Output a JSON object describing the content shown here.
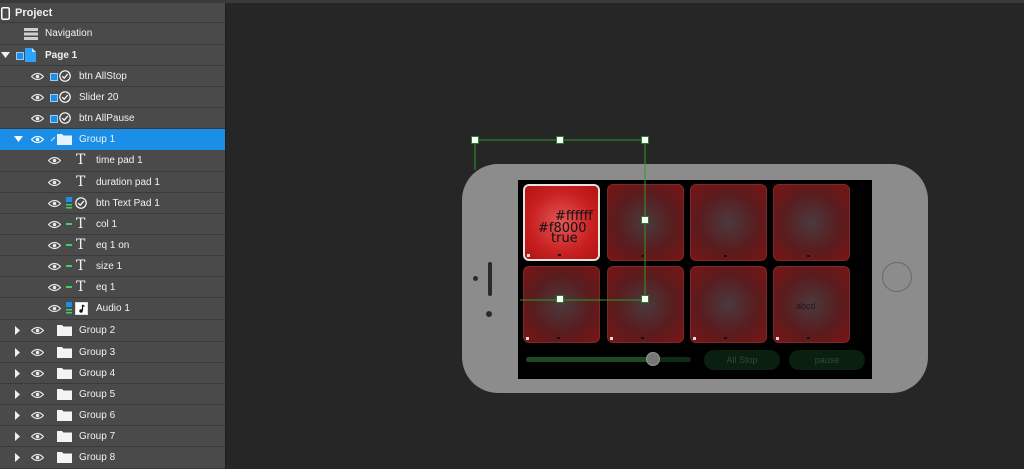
{
  "layers": {
    "project": "Project",
    "navigation": "Navigation",
    "page": "Page 1",
    "btn_allstop": "btn AllStop",
    "slider": "Slider 20",
    "btn_allpause": "btn AllPause",
    "group1": "Group 1",
    "group1_children": {
      "time_pad": "time pad 1",
      "duration_pad": "duration pad 1",
      "btn_text_pad": "btn Text Pad 1",
      "col": "col 1",
      "eq_on": "eq 1 on",
      "size": "size 1",
      "eq": "eq 1",
      "audio": "Audio 1"
    },
    "groups": [
      "Group 2",
      "Group 3",
      "Group 4",
      "Group 5",
      "Group 6",
      "Group 7",
      "Group 8"
    ]
  },
  "canvas": {
    "pad1_text": [
      "#ffffff",
      "#f8000",
      "true"
    ],
    "pad8_text": "abcd",
    "all_stop_label": "All Stop",
    "pause_label": "pause",
    "slider_value": 0.77
  },
  "colors": {
    "selection": "#1b8fe8",
    "selection_outline": "#2a9a2a",
    "pad_red": "#c92020",
    "panel_bg": "#4a4a4a",
    "canvas_bg": "#262626"
  }
}
